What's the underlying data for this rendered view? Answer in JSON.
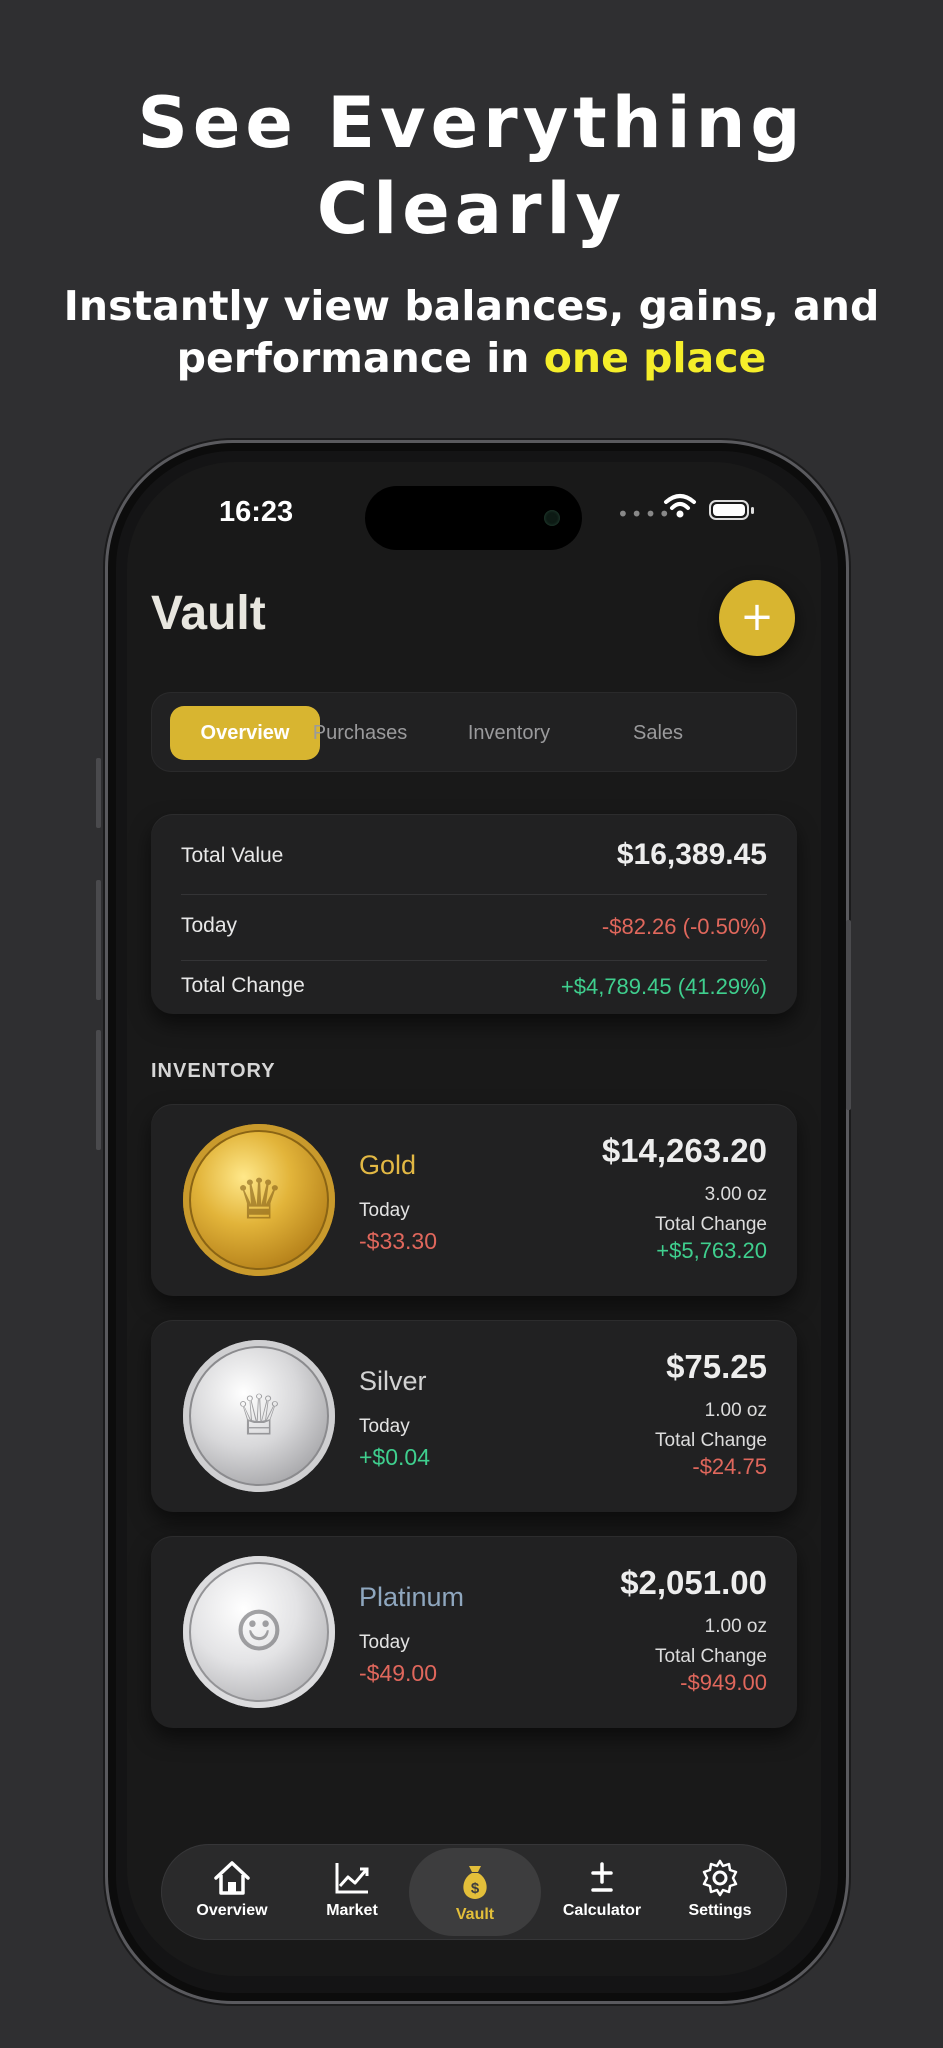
{
  "promo": {
    "headline_line1": "See Everything",
    "headline_line2": "Clearly",
    "sub_line1": "Instantly view balances, gains, and",
    "sub_line2_prefix": "performance in ",
    "sub_line2_highlight": "one place",
    "highlight_color": "#f5ee2a"
  },
  "status_bar": {
    "time": "16:23",
    "signal": "••••"
  },
  "header": {
    "title": "Vault",
    "add_icon": "plus-icon",
    "add_label": "+",
    "accent_color": "#d8b530"
  },
  "segments": [
    {
      "label": "Overview",
      "active": true
    },
    {
      "label": "Purchases",
      "active": false
    },
    {
      "label": "Inventory",
      "active": false
    },
    {
      "label": "Sales",
      "active": false
    }
  ],
  "summary": {
    "total_value_label": "Total Value",
    "total_value": "$16,389.45",
    "today_label": "Today",
    "today_value": "-$82.26 (-0.50%)",
    "total_change_label": "Total Change",
    "total_change_value": "+$4,789.45 (41.29%)"
  },
  "inventory": {
    "section_title": "INVENTORY",
    "items": [
      {
        "name": "Gold",
        "name_color": "#e2b844",
        "today_label": "Today",
        "today_change": "-$33.30",
        "value": "$14,263.20",
        "weight": "3.00 oz",
        "total_change_label": "Total Change",
        "total_change": "+$5,763.20"
      },
      {
        "name": "Silver",
        "name_color": "#d2d2d2",
        "today_label": "Today",
        "today_change": "+$0.04",
        "value": "$75.25",
        "weight": "1.00 oz",
        "total_change_label": "Total Change",
        "total_change": "-$24.75"
      },
      {
        "name": "Platinum",
        "name_color": "#8fa7bf",
        "today_label": "Today",
        "today_change": "-$49.00",
        "value": "$2,051.00",
        "weight": "1.00 oz",
        "total_change_label": "Total Change",
        "total_change": "-$949.00"
      }
    ]
  },
  "tabbar": {
    "items": [
      {
        "label": "Overview",
        "icon": "house-icon",
        "active": false
      },
      {
        "label": "Market",
        "icon": "chart-icon",
        "active": false
      },
      {
        "label": "Vault",
        "icon": "money-bag-icon",
        "active": true
      },
      {
        "label": "Calculator",
        "icon": "plus-minus-icon",
        "active": false
      },
      {
        "label": "Settings",
        "icon": "gear-icon",
        "active": false
      }
    ],
    "active_color": "#e3bf3a"
  },
  "colors": {
    "negative": "#e0675c",
    "positive": "#3fcf8e",
    "background": "#2f2f31",
    "card": "#212122"
  }
}
